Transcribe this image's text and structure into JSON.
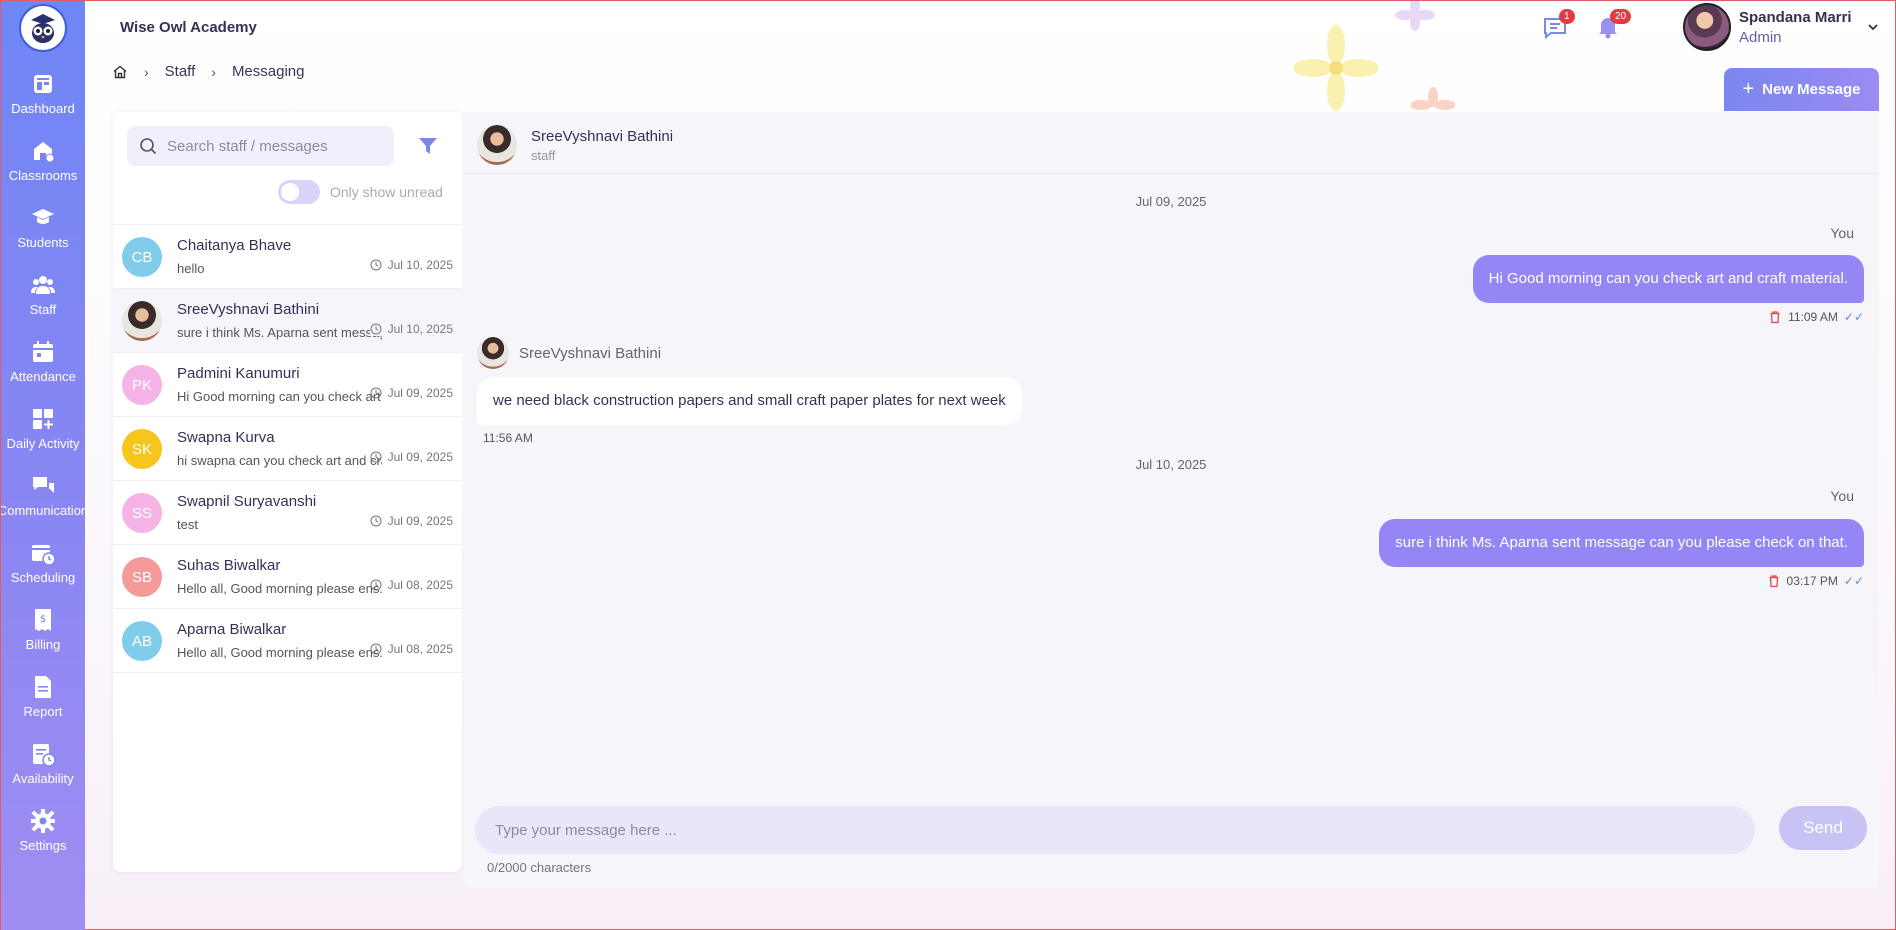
{
  "app": {
    "brand": "Wise Owl Academy"
  },
  "sidebar": {
    "items": [
      {
        "label": "Dashboard",
        "icon": "dashboard-icon"
      },
      {
        "label": "Classrooms",
        "icon": "classroom-icon"
      },
      {
        "label": "Students",
        "icon": "graduation-cap-icon"
      },
      {
        "label": "Staff",
        "icon": "people-icon"
      },
      {
        "label": "Attendance",
        "icon": "calendar-icon"
      },
      {
        "label": "Daily Activity",
        "icon": "grid-plus-icon"
      },
      {
        "label": "Communication",
        "icon": "chat-icon"
      },
      {
        "label": "Scheduling",
        "icon": "calendar-clock-icon"
      },
      {
        "label": "Billing",
        "icon": "receipt-icon"
      },
      {
        "label": "Report",
        "icon": "document-icon"
      },
      {
        "label": "Availability",
        "icon": "clipboard-clock-icon"
      },
      {
        "label": "Settings",
        "icon": "gear-icon"
      }
    ]
  },
  "breadcrumb": {
    "home_icon": "home-icon",
    "items": [
      "Staff",
      "Messaging"
    ]
  },
  "header": {
    "messages_badge": "1",
    "notifications_badge": "20",
    "user_name": "Spandana Marri",
    "user_role": "Admin",
    "new_message_label": "New Message"
  },
  "conversations": {
    "search_placeholder": "Search staff / messages",
    "unread_toggle_label": "Only show unread",
    "items": [
      {
        "initials": "CB",
        "name": "Chaitanya Bhave",
        "preview": "hello",
        "date": "Jul 10, 2025",
        "color": "#7fcdea",
        "photo": false
      },
      {
        "initials": "",
        "name": "SreeVyshnavi Bathini",
        "preview": "sure i think Ms. Aparna sent message",
        "date": "Jul 10, 2025",
        "color": "#a86a4c",
        "photo": true
      },
      {
        "initials": "PK",
        "name": "Padmini Kanumuri",
        "preview": "Hi Good morning can you check art a...",
        "date": "Jul 09, 2025",
        "color": "#f6b3e6",
        "photo": false
      },
      {
        "initials": "SK",
        "name": "Swapna Kurva",
        "preview": "hi swapna can you check art and cra...",
        "date": "Jul 09, 2025",
        "color": "#f6c51e",
        "photo": false
      },
      {
        "initials": "SS",
        "name": "Swapnil Suryavanshi",
        "preview": "test",
        "date": "Jul 09, 2025",
        "color": "#f6b3e6",
        "photo": false
      },
      {
        "initials": "SB",
        "name": "Suhas Biwalkar",
        "preview": "Hello all, Good morning please ens...",
        "date": "Jul 08, 2025",
        "color": "#f49a9a",
        "photo": false
      },
      {
        "initials": "AB",
        "name": "Aparna Biwalkar",
        "preview": "Hello all, Good morning please ens...",
        "date": "Jul 08, 2025",
        "color": "#7fcdea",
        "photo": false
      }
    ]
  },
  "chat": {
    "contact_name": "SreeVyshnavi Bathini",
    "contact_role": "staff",
    "day1": "Jul 09, 2025",
    "msg1_sender": "You",
    "msg1_text": "Hi Good morning can you check art and craft material.",
    "msg1_time": "11:09 AM",
    "msg2_sender": "SreeVyshnavi Bathini",
    "msg2_text": "we need black construction papers and small craft paper plates for next week",
    "msg2_time": "11:56 AM",
    "day2": "Jul 10, 2025",
    "msg3_sender": "You",
    "msg3_text": "sure i think Ms. Aparna sent message can you please check on that.",
    "msg3_time": "03:17 PM",
    "ticks": "✓✓",
    "composer_placeholder": "Type your message here ...",
    "char_count": "0/2000 characters",
    "send_label": "Send"
  }
}
